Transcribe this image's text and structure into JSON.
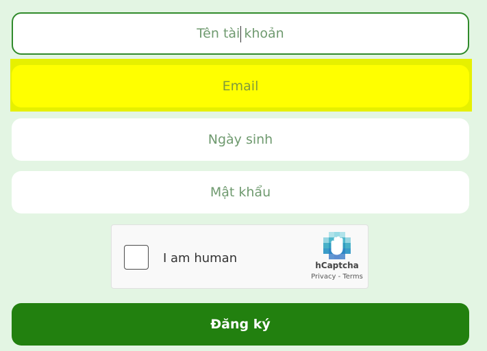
{
  "form": {
    "username_placeholder": "Tên tài khoản",
    "email_placeholder": "Email",
    "dob_placeholder": "Ngày sinh",
    "password_placeholder": "Mật khẩu",
    "submit_label": "Đăng ký"
  },
  "captcha": {
    "label": "I am human",
    "brand": "hCaptcha",
    "privacy": "Privacy",
    "separator": " - ",
    "terms": "Terms"
  },
  "colors": {
    "background": "#e3f5e3",
    "accent": "#22800f",
    "focus_border": "#2f8a2a",
    "highlight": "#ffff00"
  },
  "icons": [
    "hcaptcha-logo-icon"
  ]
}
